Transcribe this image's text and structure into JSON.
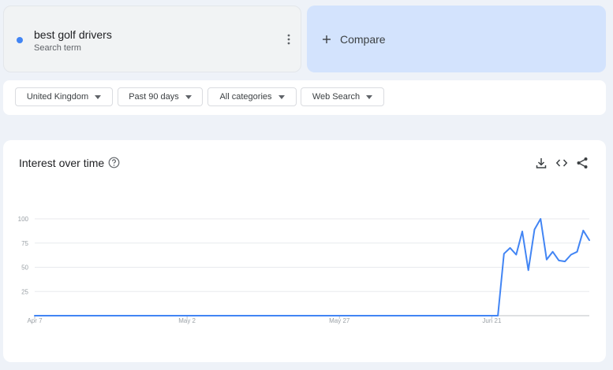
{
  "search_term": {
    "title": "best golf drivers",
    "subtitle": "Search term",
    "color": "#4285f4"
  },
  "compare": {
    "label": "Compare"
  },
  "filters": {
    "region": "United Kingdom",
    "period": "Past 90 days",
    "category": "All categories",
    "search_type": "Web Search"
  },
  "chart_card": {
    "title": "Interest over time"
  },
  "icons": {
    "more": "more-vert-icon",
    "add": "add-icon",
    "help": "help-icon",
    "download": "download-icon",
    "embed": "code-icon",
    "share": "share-icon"
  },
  "chart_data": {
    "type": "line",
    "title": "Interest over time",
    "xlabel": "",
    "ylabel": "",
    "ylim": [
      0,
      100
    ],
    "y_ticks": [
      25,
      50,
      75,
      100
    ],
    "x_tick_labels": [
      {
        "label": "Apr 7",
        "day": 0
      },
      {
        "label": "May 2",
        "day": 25
      },
      {
        "label": "May 27",
        "day": 50
      },
      {
        "label": "Jun 21",
        "day": 75
      }
    ],
    "grid": true,
    "x_range_days": [
      0,
      91
    ],
    "series": [
      {
        "color": "#4285f4",
        "start_day": 0,
        "values": [
          0,
          0,
          0,
          0,
          0,
          0,
          0,
          0,
          0,
          0,
          0,
          0,
          0,
          0,
          0,
          0,
          0,
          0,
          0,
          0,
          0,
          0,
          0,
          0,
          0,
          0,
          0,
          0,
          0,
          0,
          0,
          0,
          0,
          0,
          0,
          0,
          0,
          0,
          0,
          0,
          0,
          0,
          0,
          0,
          0,
          0,
          0,
          0,
          0,
          0,
          0,
          0,
          0,
          0,
          0,
          0,
          0,
          0,
          0,
          0,
          0,
          0,
          0,
          0,
          0,
          0,
          0,
          0,
          0,
          0,
          0,
          0,
          0,
          0,
          0,
          0,
          0,
          64,
          70,
          63,
          87,
          47,
          89,
          100,
          58,
          66,
          57,
          56,
          63,
          66,
          88,
          78
        ]
      }
    ]
  }
}
